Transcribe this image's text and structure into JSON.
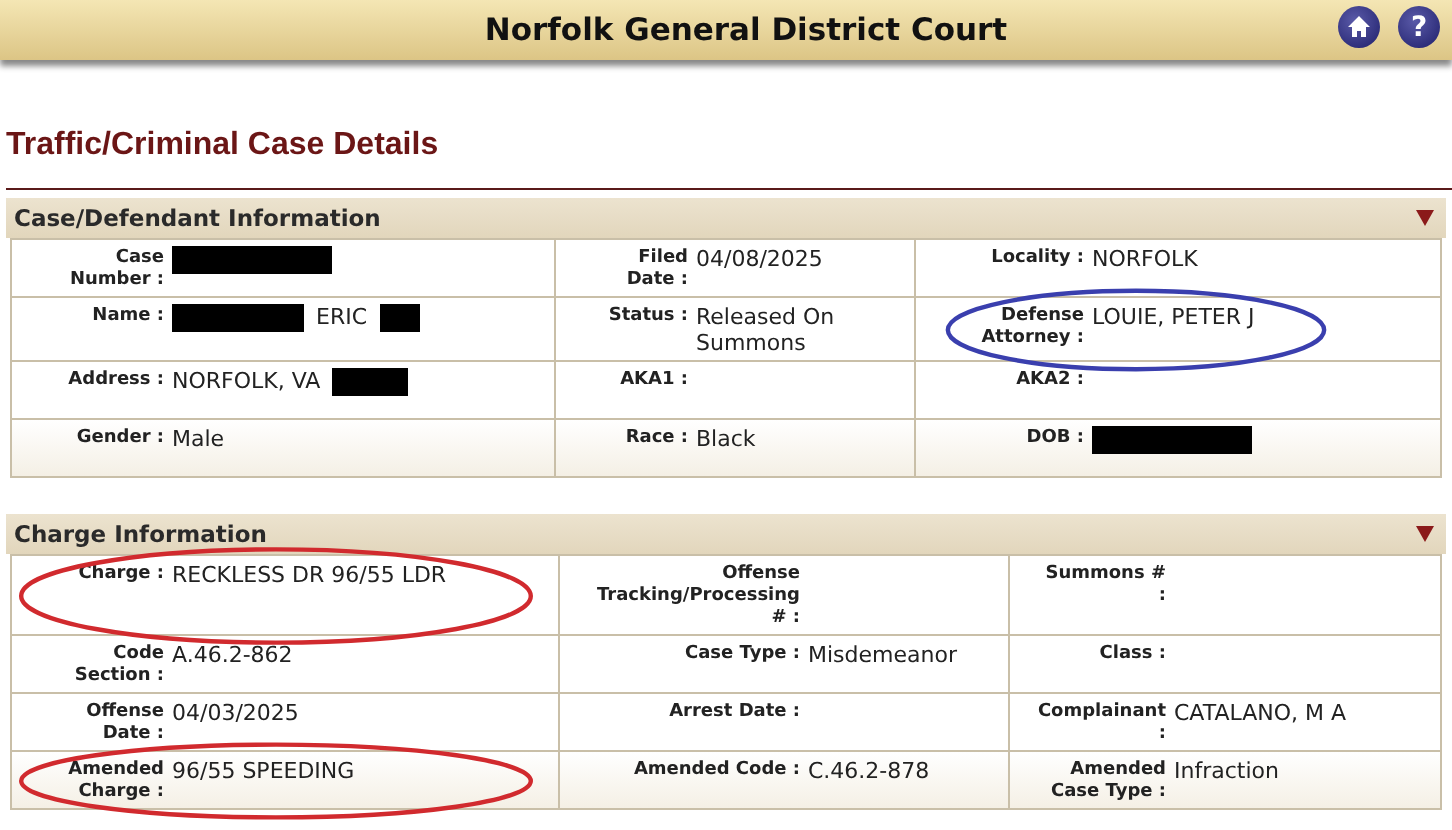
{
  "header": {
    "title": "Norfolk General District Court",
    "buttons": [
      {
        "kind": "home"
      },
      {
        "kind": "help",
        "glyph": "?"
      }
    ]
  },
  "page_title": "Traffic/Criminal Case Details",
  "sections": [
    {
      "title": "Case/Defendant Information",
      "expanded": true,
      "rows": [
        [
          {
            "label": "Case Number :",
            "value": [
              {
                "kind": "redacted"
              }
            ]
          },
          {
            "label": "Filed Date :",
            "value": [
              {
                "kind": "text",
                "text": "04/08/2025"
              }
            ]
          },
          {
            "label": "Locality :",
            "value": [
              {
                "kind": "text",
                "text": "NORFOLK"
              }
            ]
          }
        ],
        [
          {
            "label": "Name :",
            "value": [
              {
                "kind": "redacted"
              },
              {
                "kind": "text",
                "text": "ERIC"
              },
              {
                "kind": "redacted"
              }
            ]
          },
          {
            "label": "Status :",
            "value": [
              {
                "kind": "text",
                "text": "Released On Summons"
              }
            ]
          },
          {
            "label": "Defense Attorney :",
            "value": [
              {
                "kind": "text",
                "text": "LOUIE, PETER J"
              }
            ],
            "circled": true,
            "color": "#3a3fae"
          }
        ],
        [
          {
            "label": "Address :",
            "value": [
              {
                "kind": "text",
                "text": "NORFOLK, VA"
              },
              {
                "kind": "redacted"
              }
            ]
          },
          {
            "label": "AKA1 :"
          },
          {
            "label": "AKA2 :"
          }
        ],
        [
          {
            "label": "Gender :",
            "value": [
              {
                "kind": "text",
                "text": "Male"
              }
            ]
          },
          {
            "label": "Race :",
            "value": [
              {
                "kind": "text",
                "text": "Black"
              }
            ]
          },
          {
            "label": "DOB :",
            "value": [
              {
                "kind": "redacted"
              }
            ]
          }
        ]
      ]
    },
    {
      "title": "Charge Information",
      "expanded": true,
      "rows": [
        [
          {
            "label": "Charge :",
            "value": [
              {
                "kind": "text",
                "text": "RECKLESS DR 96/55 LDR"
              }
            ],
            "circled": true,
            "color": "#d12a2e"
          },
          {
            "label": "Offense Tracking/Processing # :"
          },
          {
            "label": "Summons # :"
          }
        ],
        [
          {
            "label": "Code Section :",
            "value": [
              {
                "kind": "text",
                "text": "A.46.2-862"
              }
            ]
          },
          {
            "label": "Case Type :",
            "value": [
              {
                "kind": "text",
                "text": "Misdemeanor"
              }
            ]
          },
          {
            "label": "Class :"
          }
        ],
        [
          {
            "label": "Offense Date :",
            "value": [
              {
                "kind": "text",
                "text": "04/03/2025"
              }
            ]
          },
          {
            "label": "Arrest Date :"
          },
          {
            "label": "Complainant :",
            "value": [
              {
                "kind": "text",
                "text": "CATALANO, M A"
              }
            ]
          }
        ],
        [
          {
            "label": "Amended Charge :",
            "value": [
              {
                "kind": "text",
                "text": "96/55 SPEEDING"
              }
            ],
            "circled": true,
            "color": "#d12a2e"
          },
          {
            "label": "Amended Code :",
            "value": [
              {
                "kind": "text",
                "text": "C.46.2-878"
              }
            ]
          },
          {
            "label": "Amended Case Type :",
            "value": [
              {
                "kind": "text",
                "text": "Infraction"
              }
            ]
          }
        ]
      ]
    }
  ]
}
